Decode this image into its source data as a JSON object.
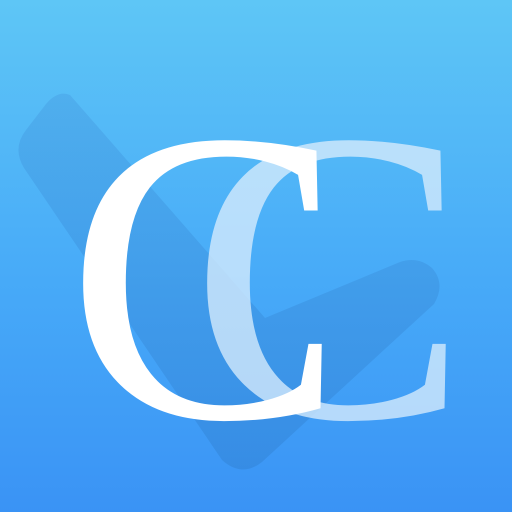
{
  "logo": {
    "front_letter": "C",
    "back_letter": "C",
    "gradient_top": "#5ec6f6",
    "gradient_bottom": "#3a93f5",
    "check_color": "#3f8fd8",
    "shape": "checkmark"
  }
}
